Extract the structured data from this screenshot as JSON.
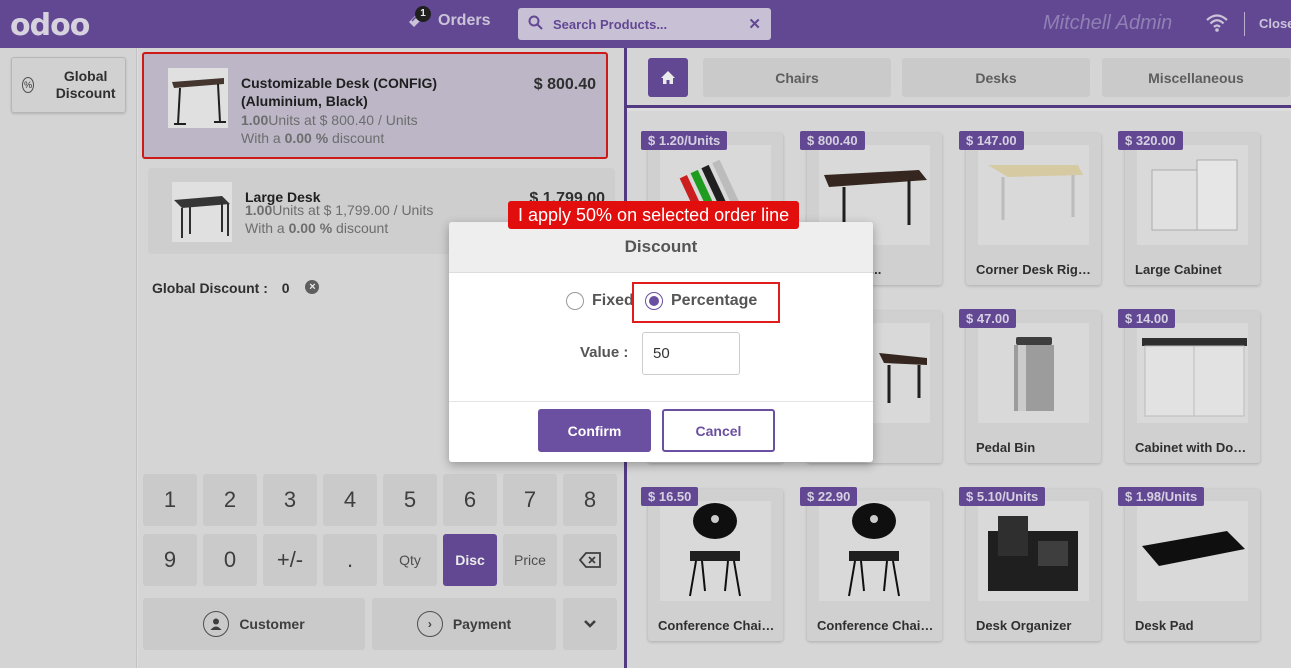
{
  "header": {
    "logo": "odoo",
    "orders_label": "Orders",
    "orders_count": "1",
    "search_placeholder": "Search Products...",
    "user": "Mitchell Admin",
    "close_label": "Close"
  },
  "left": {
    "global_discount_button": "Global Discount"
  },
  "order": {
    "lines": [
      {
        "name": "Customizable Desk (CONFIG) (Aluminium, Black)",
        "price": "$ 800.40",
        "qty": "1.00",
        "qty_text": "Units at $ 800.40 / Units",
        "disc_prefix": "With a ",
        "disc": "0.00 %",
        "disc_suffix": " discount"
      },
      {
        "name": "Large Desk",
        "price": "$ 1,799.00",
        "qty": "1.00",
        "qty_text": "Units at $ 1,799.00 / Units",
        "disc_prefix": "With a ",
        "disc": "0.00 %",
        "disc_suffix": " discount"
      }
    ],
    "global_discount_label": "Global Discount :",
    "global_discount_value": "0"
  },
  "numpad": {
    "row1": [
      "1",
      "2",
      "3",
      "4",
      "5",
      "6",
      "7",
      "8"
    ],
    "row2": [
      "9",
      "0",
      "+/-",
      ".",
      "Qty",
      "Disc",
      "Price"
    ],
    "active_mode": "Disc",
    "customer": "Customer",
    "payment": "Payment"
  },
  "categories": [
    "Chairs",
    "Desks",
    "Miscellaneous"
  ],
  "products": [
    {
      "price": "$ 1.20/Units",
      "name": ""
    },
    {
      "price": "$ 800.40",
      "name": "able Des..."
    },
    {
      "price": "$ 147.00",
      "name": "Corner Desk Right..."
    },
    {
      "price": "$ 320.00",
      "name": "Large Cabinet"
    },
    {
      "price": "",
      "name": ""
    },
    {
      "price": "",
      "name": "k"
    },
    {
      "price": "$ 47.00",
      "name": "Pedal Bin"
    },
    {
      "price": "$ 14.00",
      "name": "Cabinet with Doors"
    },
    {
      "price": "$ 16.50",
      "name": "Conference Chair..."
    },
    {
      "price": "$ 22.90",
      "name": "Conference Chair..."
    },
    {
      "price": "$ 5.10/Units",
      "name": "Desk Organizer"
    },
    {
      "price": "$ 1.98/Units",
      "name": "Desk Pad"
    }
  ],
  "modal": {
    "title": "Discount",
    "option_fixed": "Fixed",
    "option_percentage": "Percentage",
    "selected": "Percentage",
    "value_label": "Value :",
    "value": "50",
    "confirm": "Confirm",
    "cancel": "Cancel"
  },
  "annotation": "I apply 50% on selected order line",
  "colors": {
    "brand": "#6b4fa0",
    "highlight": "#e01c1c"
  }
}
